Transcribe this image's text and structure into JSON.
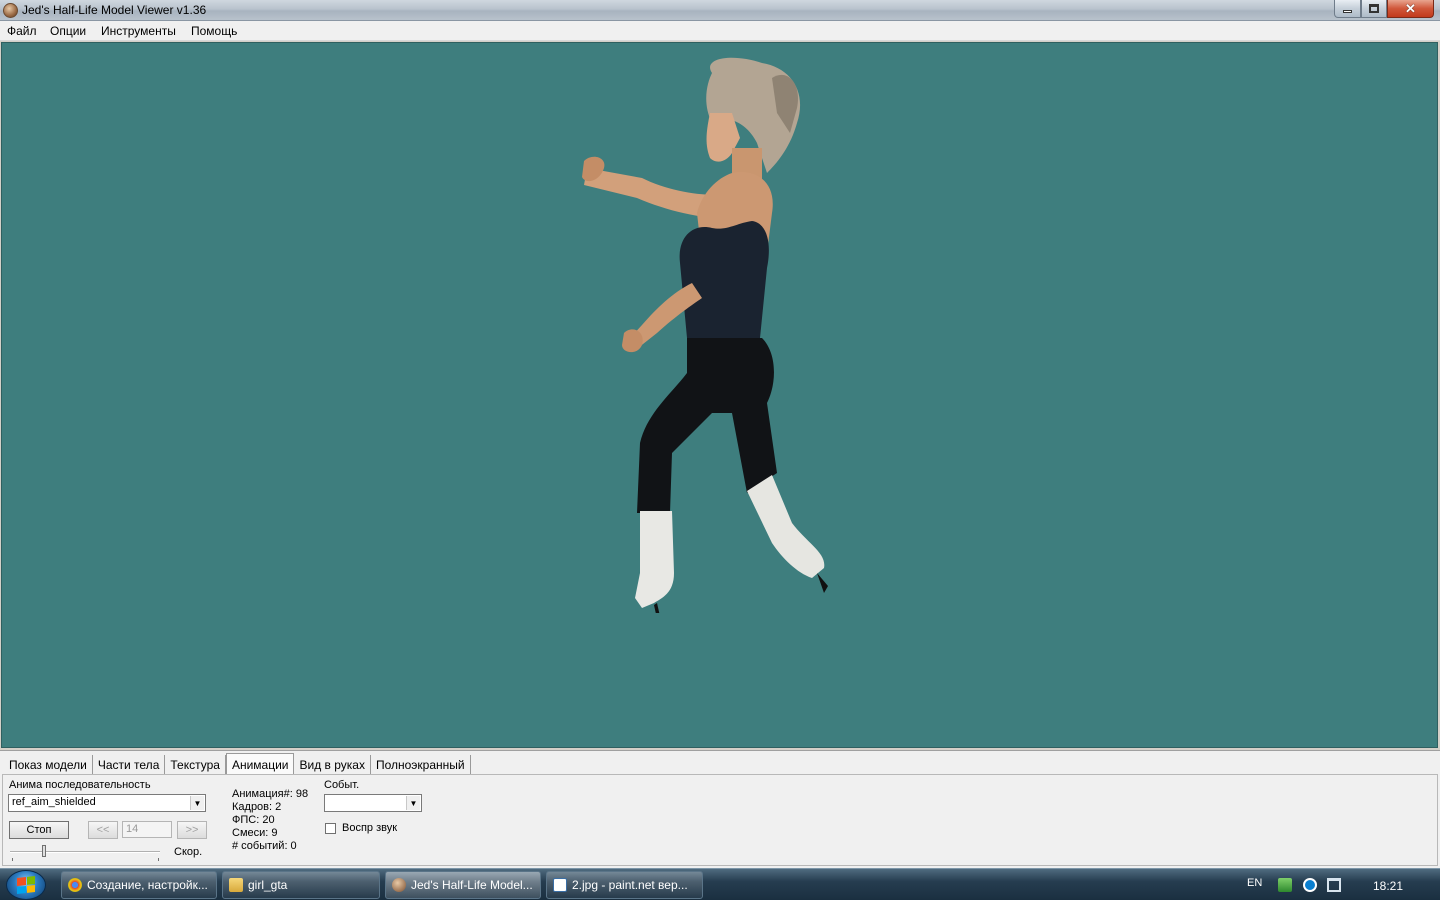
{
  "window": {
    "title": "Jed's Half-Life Model Viewer v1.36"
  },
  "menu": [
    "Файл",
    "Опции",
    "Инструменты",
    "Помощь"
  ],
  "viewport": {
    "background": "#3e7e7e",
    "content": "character-model"
  },
  "tabs": [
    "Показ модели",
    "Части тела",
    "Текстура",
    "Анимации",
    "Вид в руках",
    "Полноэкранный"
  ],
  "active_tab": "Анимации",
  "animation": {
    "sequence_label": "Анима последовательность",
    "sequence_value": "ref_aim_shielded",
    "stop_button": "Стоп",
    "prev_button": "<<",
    "next_button": ">>",
    "frame_value": "14",
    "speed_label": "Скор.",
    "info": {
      "anim_num": "Анимация#: 98",
      "frames": "Кадров: 2",
      "fps": "ФПС: 20",
      "blends": "Смеси: 9",
      "events": "# событий: 0"
    },
    "event_label": "Событ.",
    "event_value": "",
    "play_sound_label": "Воспр звук",
    "play_sound_checked": false
  },
  "taskbar": {
    "tasks": [
      {
        "label": "Создание, настройк...",
        "icon": "chrome-icon"
      },
      {
        "label": "girl_gta",
        "icon": "folder-icon"
      },
      {
        "label": "Jed's Half-Life Model...",
        "icon": "hlmv-icon"
      },
      {
        "label": "2.jpg - paint.net вер...",
        "icon": "paintnet-icon"
      }
    ],
    "language": "EN",
    "time": "18:21"
  }
}
